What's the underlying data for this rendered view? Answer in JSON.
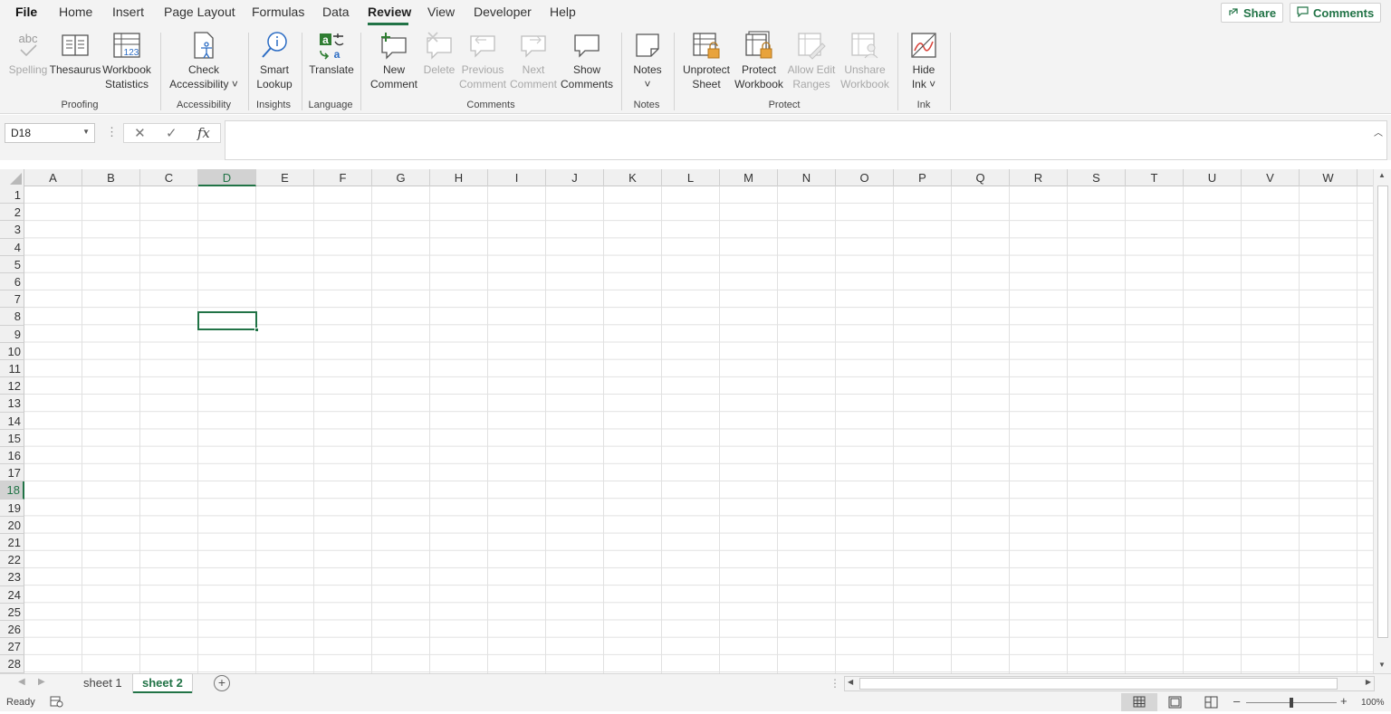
{
  "menu_tabs": [
    "File",
    "Home",
    "Insert",
    "Page Layout",
    "Formulas",
    "Data",
    "Review",
    "View",
    "Developer",
    "Help"
  ],
  "top_right": {
    "share_label": "Share",
    "comments_label": "Comments"
  },
  "ribbon": {
    "buttons": [
      {
        "l1": "Spelling",
        "l2": "",
        "badge": "abc"
      },
      {
        "l1": "Thesaurus",
        "l2": ""
      },
      {
        "l1": "Workbook",
        "l2": "Statistics",
        "badge": "123"
      },
      {
        "l1": "Check",
        "l2": "Accessibility ˅"
      },
      {
        "l1": "Smart",
        "l2": "Lookup"
      },
      {
        "l1": "Translate",
        "l2": ""
      },
      {
        "l1": "New",
        "l2": "Comment"
      },
      {
        "l1": "Delete",
        "l2": ""
      },
      {
        "l1": "Previous",
        "l2": "Comment"
      },
      {
        "l1": "Next",
        "l2": "Comment"
      },
      {
        "l1": "Show",
        "l2": "Comments"
      },
      {
        "l1": "Notes",
        "l2": "˅"
      },
      {
        "l1": "Unprotect",
        "l2": "Sheet"
      },
      {
        "l1": "Protect",
        "l2": "Workbook"
      },
      {
        "l1": "Allow Edit",
        "l2": "Ranges"
      },
      {
        "l1": "Unshare",
        "l2": "Workbook"
      },
      {
        "l1": "Hide",
        "l2": "Ink ˅"
      }
    ],
    "groups": [
      "Proofing",
      "Accessibility",
      "Insights",
      "Language",
      "Comments",
      "Notes",
      "Protect",
      "Ink"
    ]
  },
  "name_box": "D18",
  "fx_label": "fx",
  "columns": [
    "A",
    "B",
    "C",
    "D",
    "E",
    "F",
    "G",
    "H",
    "I",
    "J",
    "K",
    "L",
    "M",
    "N",
    "O",
    "P",
    "Q",
    "R",
    "S",
    "T",
    "U",
    "V",
    "W"
  ],
  "rows": [
    "1",
    "2",
    "3",
    "4",
    "5",
    "6",
    "7",
    "8",
    "9",
    "10",
    "11",
    "12",
    "13",
    "14",
    "15",
    "16",
    "17",
    "18",
    "19",
    "20",
    "21",
    "22",
    "23",
    "24",
    "25",
    "26",
    "27",
    "28"
  ],
  "selected_cell": {
    "column": "D",
    "row": "18"
  },
  "sheets": [
    "sheet 1",
    "sheet 2"
  ],
  "active_sheet": "sheet 2",
  "status": {
    "ready": "Ready",
    "zoom": "100%"
  },
  "colors": {
    "accent": "#217346"
  }
}
